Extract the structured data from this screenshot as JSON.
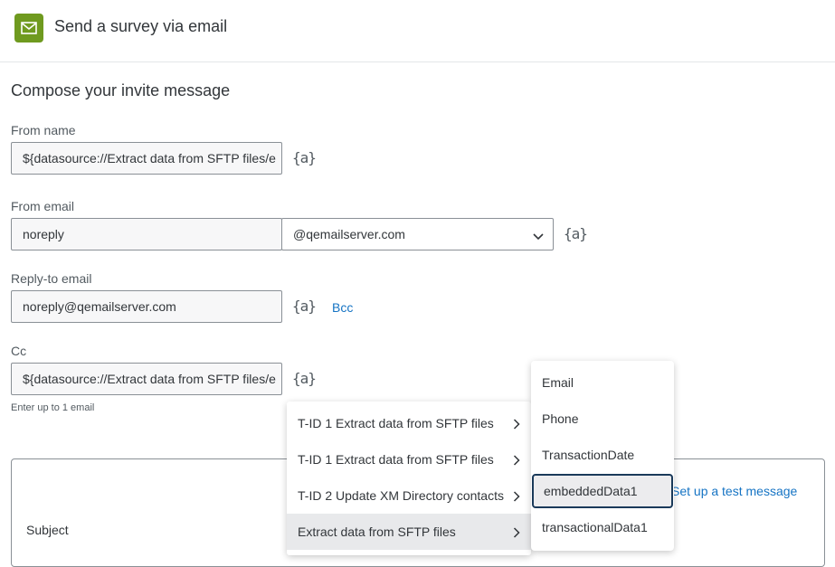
{
  "header": {
    "title": "Send a survey via email",
    "icon": "mail-icon"
  },
  "compose": {
    "title": "Compose your invite message",
    "from_name": {
      "label": "From name",
      "value": "${datasource://Extract data from SFTP files/e"
    },
    "from_email": {
      "label": "From email",
      "value": "noreply",
      "domain": "@qemailserver.com"
    },
    "reply_to": {
      "label": "Reply-to email",
      "value": "noreply@qemailserver.com",
      "bcc": "Bcc"
    },
    "cc": {
      "label": "Cc",
      "value": "${datasource://Extract data from SFTP files/e",
      "hint": "Enter up to 1 email"
    },
    "piped_text": "{a}",
    "subject_label": "Subject",
    "test_message_link": "Set up a test message"
  },
  "source_menu": {
    "items": [
      {
        "label": "T-ID 1 Extract data from SFTP files"
      },
      {
        "label": "T-ID 1 Extract data from SFTP files"
      },
      {
        "label": "T-ID 2 Update XM Directory contacts"
      },
      {
        "label": "Extract data from SFTP files"
      }
    ]
  },
  "field_menu": {
    "items": [
      {
        "label": "Email"
      },
      {
        "label": "Phone"
      },
      {
        "label": "TransactionDate"
      },
      {
        "label": "embeddedData1"
      },
      {
        "label": "transactionalData1"
      }
    ]
  },
  "colors": {
    "brand": "#6f9a1f",
    "link": "#1674c4",
    "focus": "#1a3a5a"
  }
}
